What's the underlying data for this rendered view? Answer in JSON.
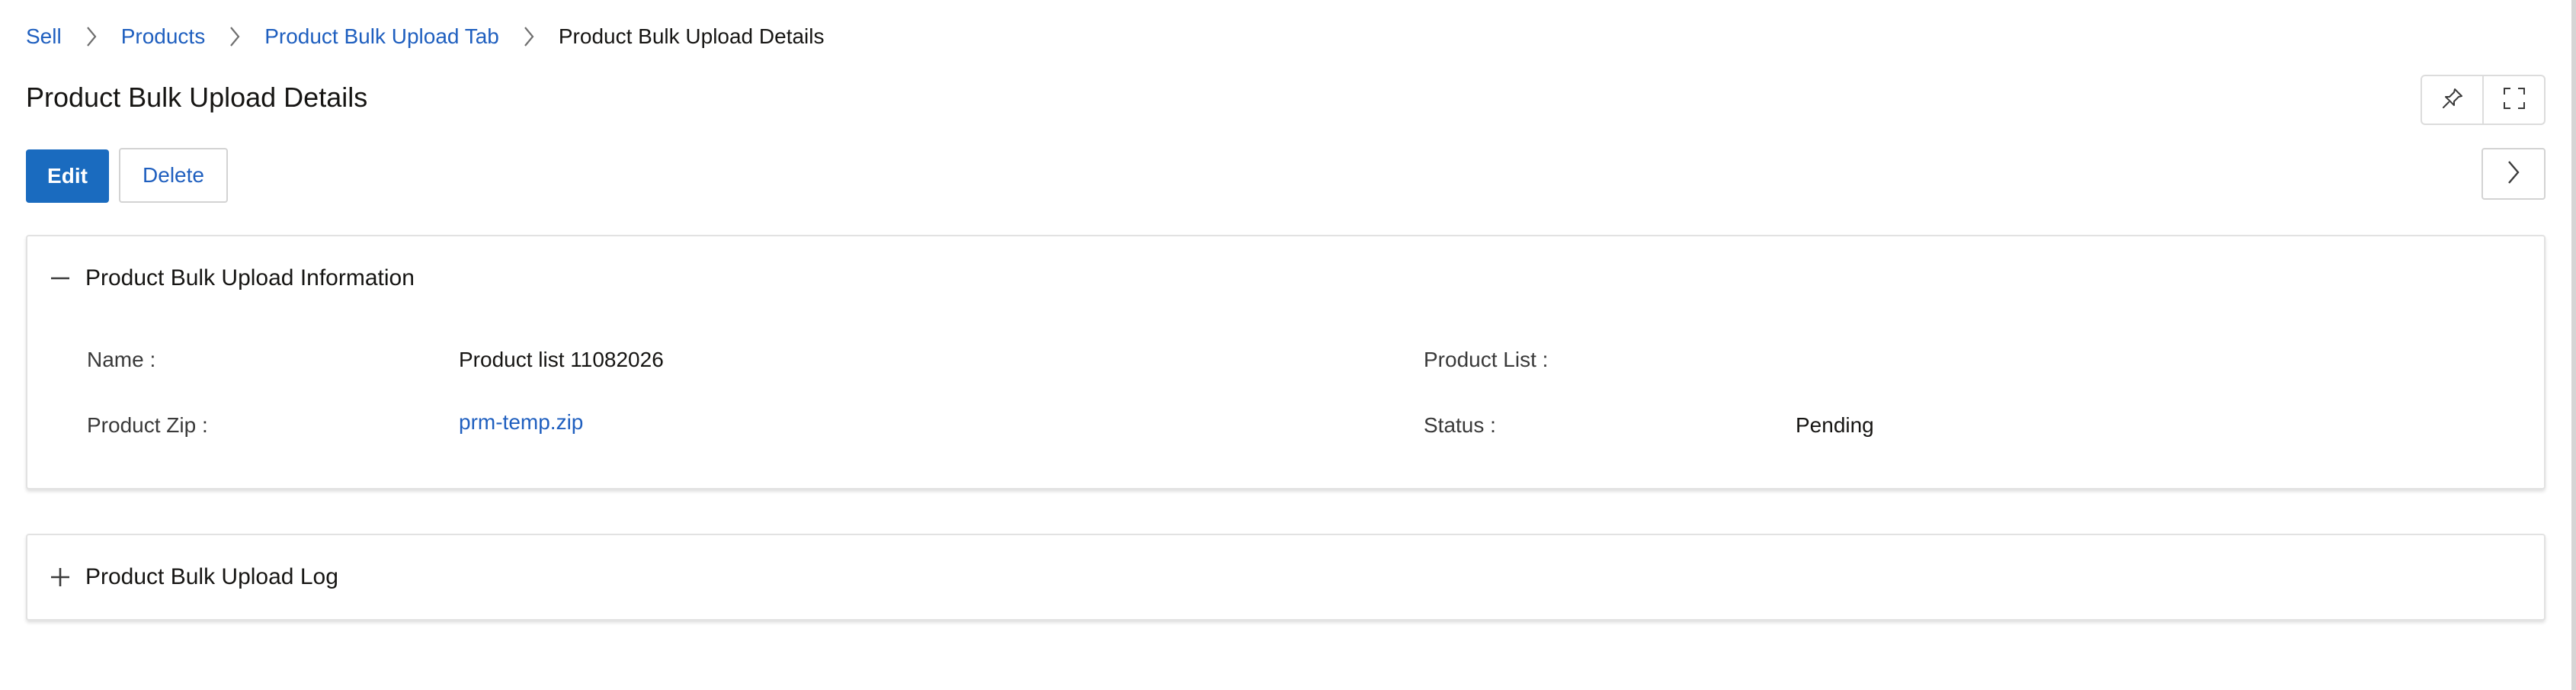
{
  "breadcrumb": {
    "items": [
      {
        "label": "Sell"
      },
      {
        "label": "Products"
      },
      {
        "label": "Product Bulk Upload Tab"
      },
      {
        "label": "Product Bulk Upload Details"
      }
    ],
    "separator_icon": "chevron-right-icon"
  },
  "page": {
    "title": "Product Bulk Upload Details"
  },
  "top_actions": {
    "pin_icon": "pin-icon",
    "expand_icon": "fullscreen-icon"
  },
  "actions": {
    "edit_label": "Edit",
    "delete_label": "Delete",
    "next_icon": "chevron-right-icon"
  },
  "info_panel": {
    "title": "Product Bulk Upload Information",
    "toggle_icon": "collapse-minus-icon",
    "fields": {
      "name_label": "Name :",
      "name_value": "Product list 11082026",
      "product_list_label": "Product List :",
      "product_list_value": "",
      "product_zip_label": "Product Zip :",
      "product_zip_value": "prm-temp.zip",
      "status_label": "Status :",
      "status_value": "Pending"
    }
  },
  "log_panel": {
    "title": "Product Bulk Upload Log",
    "toggle_icon": "expand-plus-icon"
  },
  "colors": {
    "accent": "#1a6bbf",
    "link": "#1f5fbf",
    "text": "#161513",
    "border": "#e2e2e2"
  }
}
